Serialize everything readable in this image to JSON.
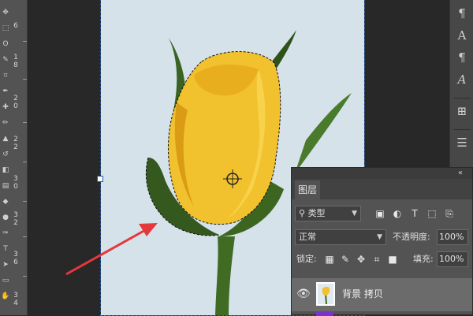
{
  "ruler": {
    "ticks": [
      "6",
      "1",
      "8",
      "2",
      "0",
      "2",
      "2",
      "2",
      "4",
      "2",
      "6",
      "2",
      "8",
      "3",
      "0",
      "3",
      "2",
      "3",
      "4",
      "3",
      "6"
    ]
  },
  "right_panel": {
    "icons": [
      {
        "name": "paragraph-icon",
        "glyph": "¶"
      },
      {
        "name": "character-icon",
        "glyph": "A"
      },
      {
        "name": "paragraph-styles-icon",
        "glyph": "¶"
      },
      {
        "name": "character-styles-icon",
        "glyph": "A"
      },
      {
        "name": "table-icon",
        "glyph": "⊞"
      },
      {
        "name": "properties-icon",
        "glyph": "☰"
      }
    ]
  },
  "layers_panel": {
    "tab_label": "图层",
    "collapse_glyph": "«",
    "filter": {
      "icon": "search-icon",
      "value": "类型"
    },
    "blend_mode": "正常",
    "opacity_label": "不透明度:",
    "opacity_value": "100%",
    "lock_label": "锁定:",
    "fill_label": "填充:",
    "fill_value": "100%",
    "layer": {
      "name": "背景 拷贝",
      "visible": true
    }
  },
  "colors": {
    "accent": "#2a5aa0",
    "arrow": "#e5383b",
    "rose": "#f2c12e",
    "stem": "#3f6b23",
    "canvas": "#d5e2ea"
  }
}
